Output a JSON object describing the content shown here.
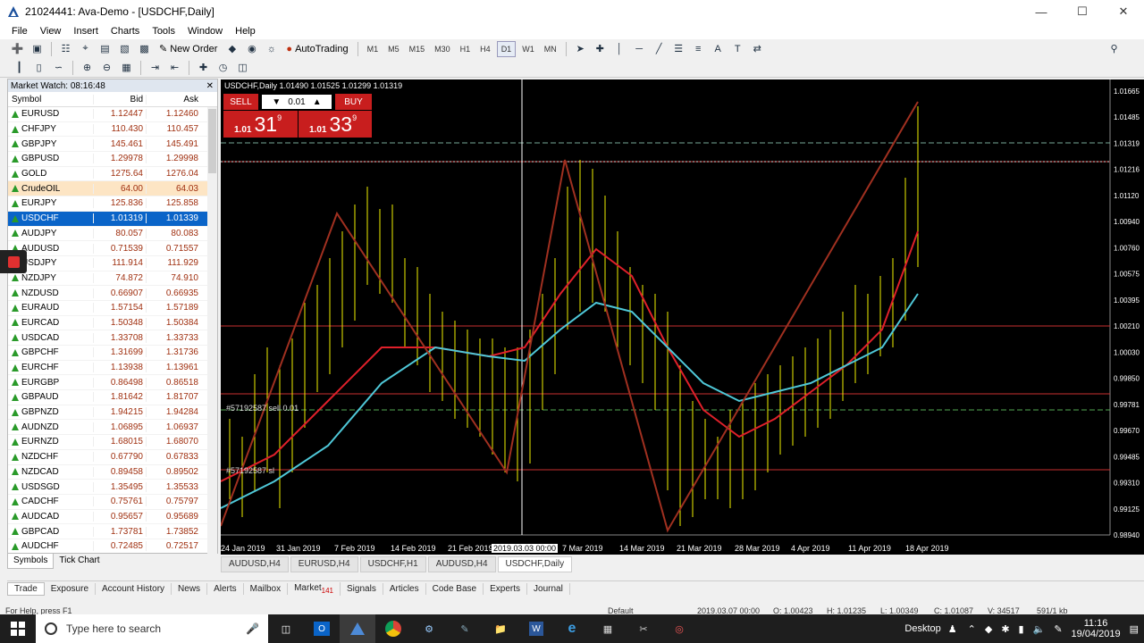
{
  "window": {
    "title": "21024441: Ava-Demo - [USDCHF,Daily]"
  },
  "menu": [
    "File",
    "View",
    "Insert",
    "Charts",
    "Tools",
    "Window",
    "Help"
  ],
  "toolbar": {
    "new_order": "New Order",
    "autotrading": "AutoTrading",
    "timeframes": [
      "M1",
      "M5",
      "M15",
      "M30",
      "H1",
      "H4",
      "D1",
      "W1",
      "MN"
    ],
    "active_tf": "D1"
  },
  "market_watch": {
    "title": "Market Watch: 08:16:48",
    "col_symbol": "Symbol",
    "col_bid": "Bid",
    "col_ask": "Ask",
    "rows": [
      {
        "symbol": "EURUSD",
        "bid": "1.12447",
        "ask": "1.12460"
      },
      {
        "symbol": "CHFJPY",
        "bid": "110.430",
        "ask": "110.457"
      },
      {
        "symbol": "GBPJPY",
        "bid": "145.461",
        "ask": "145.491"
      },
      {
        "symbol": "GBPUSD",
        "bid": "1.29978",
        "ask": "1.29998"
      },
      {
        "symbol": "GOLD",
        "bid": "1275.64",
        "ask": "1276.04"
      },
      {
        "symbol": "CrudeOIL",
        "bid": "64.00",
        "ask": "64.03"
      },
      {
        "symbol": "EURJPY",
        "bid": "125.836",
        "ask": "125.858"
      },
      {
        "symbol": "USDCHF",
        "bid": "1.01319",
        "ask": "1.01339"
      },
      {
        "symbol": "AUDJPY",
        "bid": "80.057",
        "ask": "80.083"
      },
      {
        "symbol": "AUDUSD",
        "bid": "0.71539",
        "ask": "0.71557"
      },
      {
        "symbol": "USDJPY",
        "bid": "111.914",
        "ask": "111.929"
      },
      {
        "symbol": "NZDJPY",
        "bid": "74.872",
        "ask": "74.910"
      },
      {
        "symbol": "NZDUSD",
        "bid": "0.66907",
        "ask": "0.66935"
      },
      {
        "symbol": "EURAUD",
        "bid": "1.57154",
        "ask": "1.57189"
      },
      {
        "symbol": "EURCAD",
        "bid": "1.50348",
        "ask": "1.50384"
      },
      {
        "symbol": "USDCAD",
        "bid": "1.33708",
        "ask": "1.33733"
      },
      {
        "symbol": "GBPCHF",
        "bid": "1.31699",
        "ask": "1.31736"
      },
      {
        "symbol": "EURCHF",
        "bid": "1.13938",
        "ask": "1.13961"
      },
      {
        "symbol": "EURGBP",
        "bid": "0.86498",
        "ask": "0.86518"
      },
      {
        "symbol": "GBPAUD",
        "bid": "1.81642",
        "ask": "1.81707"
      },
      {
        "symbol": "GBPNZD",
        "bid": "1.94215",
        "ask": "1.94284"
      },
      {
        "symbol": "AUDNZD",
        "bid": "1.06895",
        "ask": "1.06937"
      },
      {
        "symbol": "EURNZD",
        "bid": "1.68015",
        "ask": "1.68070"
      },
      {
        "symbol": "NZDCHF",
        "bid": "0.67790",
        "ask": "0.67833"
      },
      {
        "symbol": "NZDCAD",
        "bid": "0.89458",
        "ask": "0.89502"
      },
      {
        "symbol": "USDSGD",
        "bid": "1.35495",
        "ask": "1.35533"
      },
      {
        "symbol": "CADCHF",
        "bid": "0.75761",
        "ask": "0.75797"
      },
      {
        "symbol": "AUDCAD",
        "bid": "0.95657",
        "ask": "0.95689"
      },
      {
        "symbol": "GBPCAD",
        "bid": "1.73781",
        "ask": "1.73852"
      },
      {
        "symbol": "AUDCHF",
        "bid": "0.72485",
        "ask": "0.72517"
      }
    ],
    "selected": "USDCHF",
    "highlighted": "CrudeOIL",
    "tabs": [
      "Symbols",
      "Tick Chart"
    ]
  },
  "chart": {
    "header": "USDCHF,Daily  1.01490 1.01525 1.01299 1.01319",
    "sell": "SELL",
    "buy": "BUY",
    "lot": "0.01",
    "sell_price_small": "1.01",
    "sell_price_big": "31",
    "sell_price_sup": "9",
    "buy_price_small": "1.01",
    "buy_price_big": "33",
    "buy_price_sup": "9",
    "order_label_1": "#57192587 sell 0.01",
    "order_label_2": "#57192587 sl",
    "crosshair_date": "2019.03.03 00:00",
    "price_labels": [
      "1.01665",
      "1.01485",
      "1.01319",
      "1.01216",
      "1.01120",
      "1.00940",
      "1.00760",
      "1.00575",
      "1.00395",
      "1.00210",
      "1.00030",
      "0.99850",
      "0.99781",
      "0.99670",
      "0.99485",
      "0.99310",
      "0.99125",
      "0.98940"
    ],
    "date_labels": [
      "24 Jan 2019",
      "31 Jan 2019",
      "7 Feb 2019",
      "14 Feb 2019",
      "21 Feb 2019",
      "7 Mar 2019",
      "14 Mar 2019",
      "21 Mar 2019",
      "28 Mar 2019",
      "4 Apr 2019",
      "11 Apr 2019",
      "18 Apr 2019"
    ],
    "tabs": [
      "AUDUSD,H4",
      "EURUSD,H4",
      "USDCHF,H1",
      "AUDUSD,H4",
      "USDCHF,Daily"
    ],
    "active_tab": "USDCHF,Daily"
  },
  "terminal_tabs": [
    "Trade",
    "Exposure",
    "Account History",
    "News",
    "Alerts",
    "Mailbox",
    "Market",
    "Signals",
    "Articles",
    "Code Base",
    "Experts",
    "Journal"
  ],
  "market_badge": "141",
  "status": {
    "help": "For Help, press F1",
    "profile": "Default",
    "datetime": "2019.03.07 00:00",
    "open": "O: 1.00423",
    "high": "H: 1.01235",
    "low": "L: 1.00349",
    "close": "C: 1.01087",
    "volume": "V: 34517",
    "traffic": "591/1 kb"
  },
  "taskbar": {
    "search": "Type here to search",
    "desktop": "Desktop",
    "time": "11:16",
    "date": "19/04/2019"
  }
}
